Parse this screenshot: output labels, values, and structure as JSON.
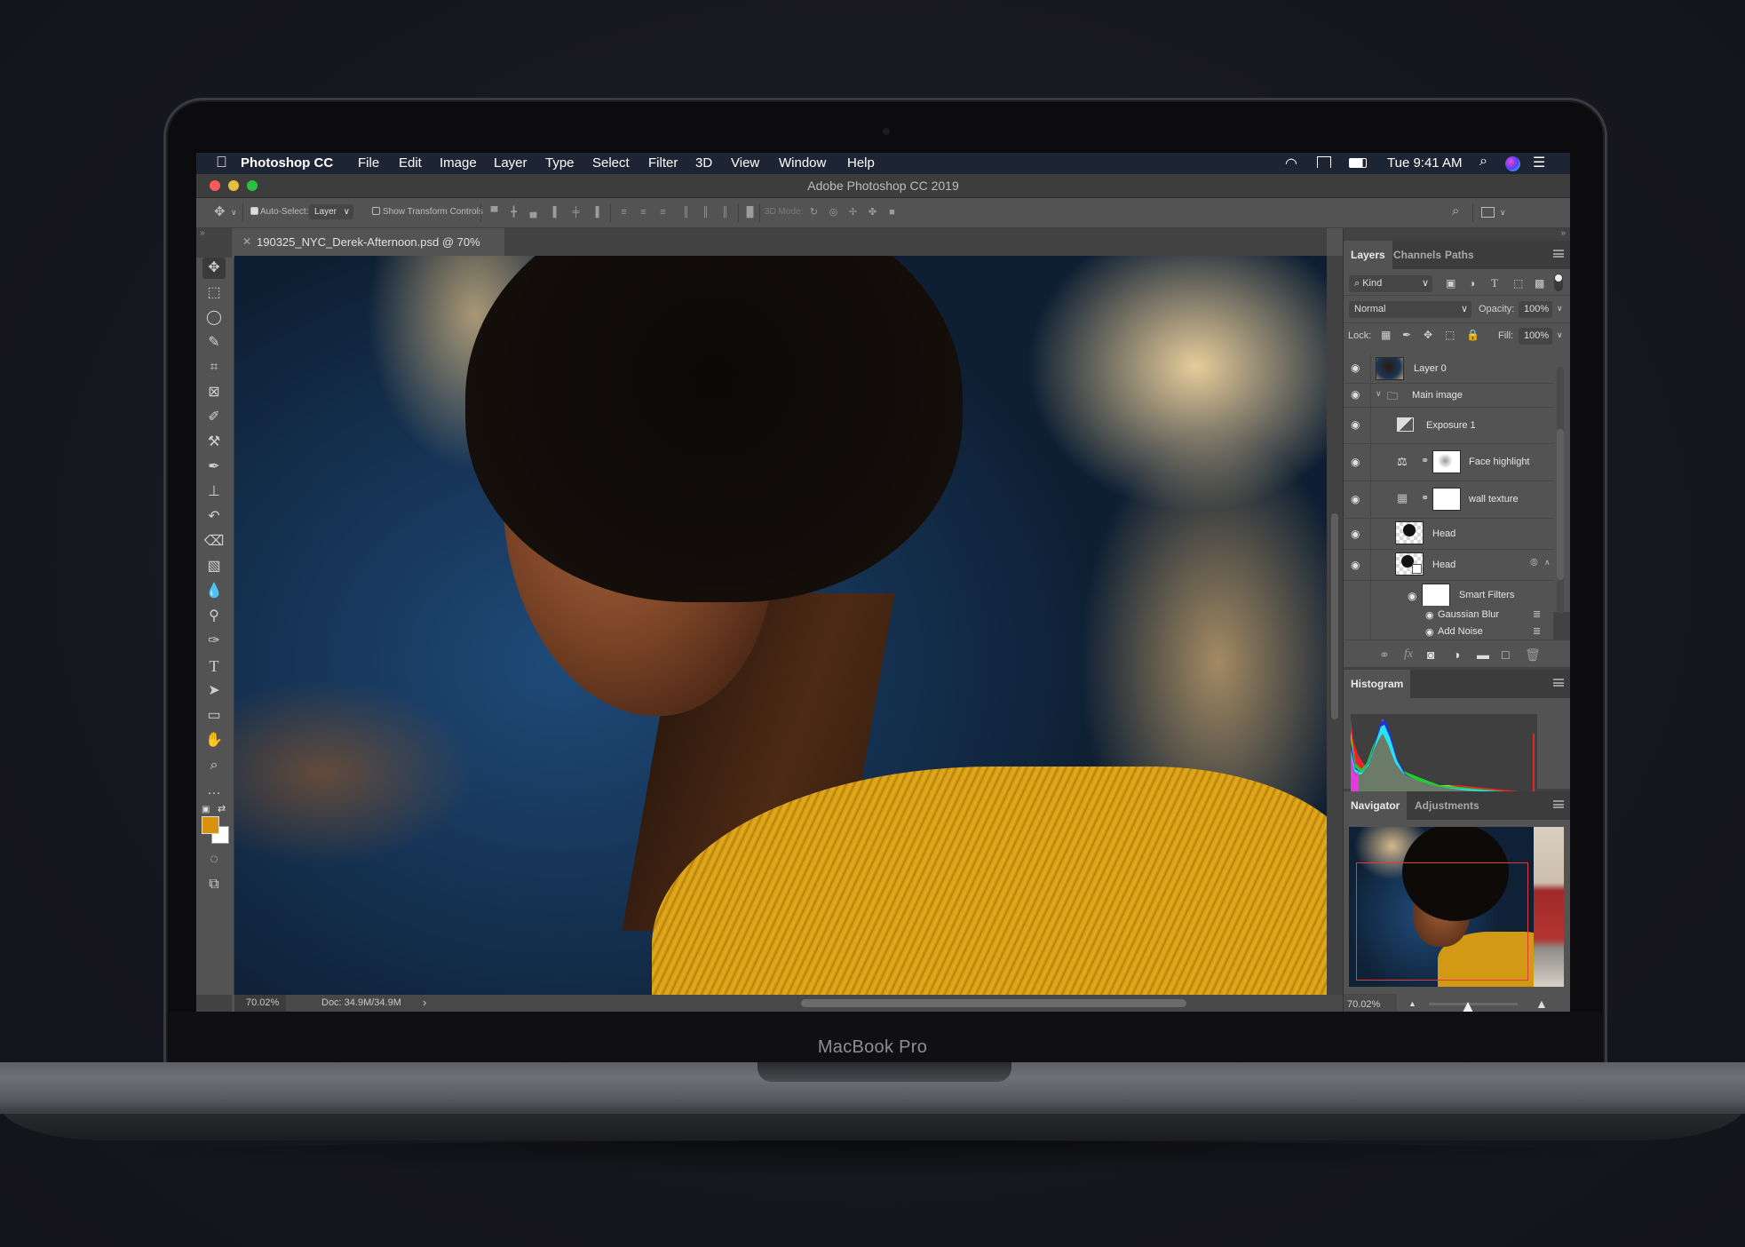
{
  "device": {
    "brand_label": "MacBook Pro"
  },
  "menubar": {
    "app_name": "Photoshop CC",
    "items": [
      "File",
      "Edit",
      "Image",
      "Layer",
      "Type",
      "Select",
      "Filter",
      "3D",
      "View",
      "Window",
      "Help"
    ],
    "clock": "Tue 9:41 AM",
    "status_icons": [
      "wifi-icon",
      "airplay-icon",
      "battery-icon",
      "spotlight-icon",
      "siri-icon",
      "notification-center-icon"
    ]
  },
  "window": {
    "title": "Adobe Photoshop CC 2019",
    "traffic_lights": {
      "close": "#fc5b57",
      "minimize": "#e5bf3c",
      "zoom": "#2ac140"
    }
  },
  "options_bar": {
    "auto_select_label": "Auto-Select:",
    "auto_select_checked": true,
    "auto_select_target": "Layer",
    "show_transform_label": "Show Transform Controls",
    "show_transform_checked": false,
    "mode_3d_label": "3D Mode:"
  },
  "document": {
    "tab_title": "190325_NYC_Derek-Afternoon.psd @ 70% (RGB/8)",
    "zoom": "70.02%",
    "doc_info": "Doc: 34.9M/34.9M"
  },
  "tools": [
    "move-tool",
    "marquee-tool",
    "lasso-tool",
    "quick-selection-tool",
    "crop-tool",
    "frame-tool",
    "eyedropper-tool",
    "healing-brush-tool",
    "brush-tool",
    "clone-stamp-tool",
    "history-brush-tool",
    "eraser-tool",
    "gradient-tool",
    "blur-tool",
    "dodge-tool",
    "pen-tool",
    "type-tool",
    "path-selection-tool",
    "rectangle-tool",
    "hand-tool",
    "zoom-tool",
    "edit-toolbar"
  ],
  "colors": {
    "foreground": "#d9920e",
    "background": "#ffffff"
  },
  "layers_panel": {
    "tabs": [
      "Layers",
      "Channels",
      "Paths"
    ],
    "active_tab": "Layers",
    "filter_kind": "Kind",
    "blend_mode": "Normal",
    "opacity_label": "Opacity:",
    "opacity": "100%",
    "lock_label": "Lock:",
    "fill_label": "Fill:",
    "fill": "100%",
    "layers": [
      {
        "name": "Layer 0",
        "type": "pixel"
      },
      {
        "name": "Main image",
        "type": "group"
      },
      {
        "name": "Exposure 1",
        "type": "adjustment-exposure"
      },
      {
        "name": "Face highlight",
        "type": "adjustment-color-balance"
      },
      {
        "name": "wall texture",
        "type": "adjustment-curves"
      },
      {
        "name": "Head",
        "type": "pixel"
      },
      {
        "name": "Head",
        "type": "smart-object"
      },
      {
        "name": "Smart Filters",
        "type": "smart-filters"
      },
      {
        "name": "Gaussian Blur",
        "type": "filter"
      },
      {
        "name": "Add Noise",
        "type": "filter"
      }
    ]
  },
  "histogram_panel": {
    "title": "Histogram"
  },
  "navigator_panel": {
    "tabs": [
      "Navigator",
      "Adjustments"
    ],
    "active_tab": "Navigator",
    "zoom": "70.02%"
  }
}
